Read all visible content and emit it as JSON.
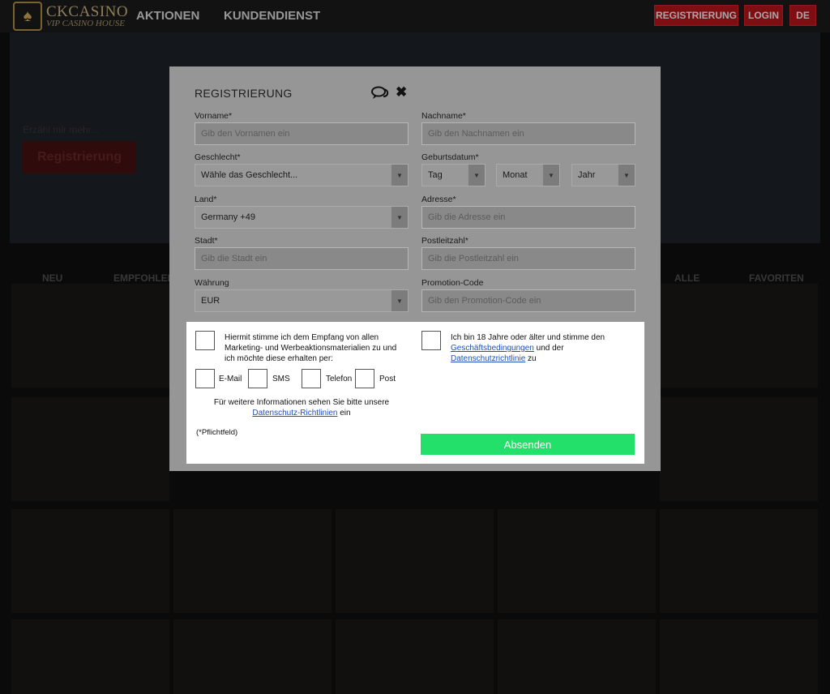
{
  "header": {
    "logo": {
      "name": "CKCASINO",
      "sub": "VIP CASINO HOUSE"
    },
    "nav": [
      "AKTIONEN",
      "KUNDENDIENST"
    ],
    "buttons": {
      "register": "REGISTRIERUNG",
      "login": "LOGIN",
      "lang": "DE"
    }
  },
  "background": {
    "hero_sub": "Erzähl mir mehr...",
    "hero_button": "Registrierung",
    "tabs": [
      "NEU",
      "EMPFOHLEN",
      "ALLE",
      "FAVORITEN"
    ]
  },
  "modal": {
    "title": "REGISTRIERUNG",
    "fields": {
      "vorname": {
        "label": "Vorname*",
        "placeholder": "Gib den Vornamen ein"
      },
      "nachname": {
        "label": "Nachname*",
        "placeholder": "Gib den Nachnamen ein"
      },
      "geschlecht": {
        "label": "Geschlecht*",
        "value": "Wähle das Geschlecht..."
      },
      "geburtsdatum": {
        "label": "Geburtsdatum*",
        "tag": "Tag",
        "monat": "Monat",
        "jahr": "Jahr"
      },
      "land": {
        "label": "Land*",
        "value": "Germany +49"
      },
      "adresse": {
        "label": "Adresse*",
        "placeholder": "Gib die Adresse ein"
      },
      "stadt": {
        "label": "Stadt*",
        "placeholder": "Gib die Stadt ein"
      },
      "postleitzahl": {
        "label": "Postleitzahl*",
        "placeholder": "Gib die Postleitzahl ein"
      },
      "waehrung": {
        "label": "Währung",
        "value": "EUR"
      },
      "promotion": {
        "label": "Promotion-Code",
        "placeholder": "Gib den Promotion-Code ein"
      }
    },
    "consent": {
      "marketing": "Hiermit stimme ich dem Empfang von allen Marketing- und Werbeaktionsmaterialien zu und ich möchte diese erhalten per:",
      "channels": [
        "E-Mail",
        "SMS",
        "Telefon",
        "Post"
      ],
      "info": "Für weitere Informationen sehen Sie bitte unsere",
      "info_link": "Datenschutz-Richtlinien",
      "info_suffix": "ein",
      "required": "(*Pflichtfeld)",
      "age_prefix": "Ich bin 18 Jahre oder älter und stimme den",
      "age_link1": "Geschäftsbedingungen",
      "age_mid": "und der",
      "age_link2": "Datenschutzrichtlinie",
      "age_suffix": "zu"
    },
    "submit": "Absenden"
  }
}
